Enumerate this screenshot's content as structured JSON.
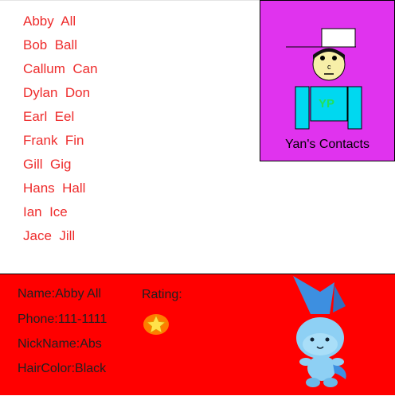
{
  "contacts": [
    {
      "name": "Abby  All"
    },
    {
      "name": "Bob  Ball"
    },
    {
      "name": "Callum  Can"
    },
    {
      "name": "Dylan  Don"
    },
    {
      "name": "Earl  Eel"
    },
    {
      "name": "Frank  Fin"
    },
    {
      "name": "Gill  Gig"
    },
    {
      "name": "Hans  Hall"
    },
    {
      "name": "Ian  Ice"
    },
    {
      "name": "Jace  Jill"
    }
  ],
  "header": {
    "title": "Yan's Contacts",
    "avatar_shirt_text": "YP"
  },
  "details": {
    "name": "Name:Abby All",
    "phone": "Phone:111-1111",
    "nickname": "NickName:Abs",
    "haircolor": "HairColor:Black",
    "rating_label": "Rating:",
    "rating_stars": 1
  },
  "colors": {
    "contact_text": "#ee2c2c",
    "header_bg": "#e033ee",
    "details_bg": "#ff0000",
    "avatar_body": "#00d8f0",
    "avatar_face": "#f7efa8"
  },
  "icons": [
    "contacts-avatar-icon",
    "star-icon",
    "mascot-icon"
  ]
}
